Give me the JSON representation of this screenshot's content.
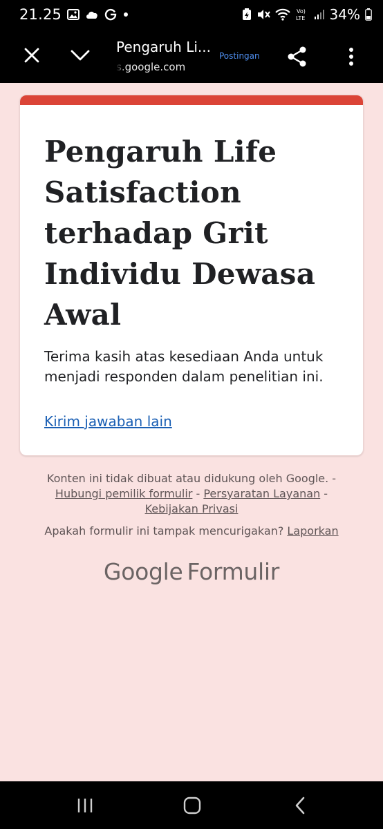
{
  "status_bar": {
    "time": "21.25",
    "battery": "34%",
    "network_label": "Vo) LTE"
  },
  "toolbar": {
    "tab_title": "Pengaruh Li...",
    "url": "s.google.com",
    "action_label": "Postingan"
  },
  "form": {
    "accent_color": "#db4437",
    "title": "Pengaruh Life Satisfaction terhadap Grit Individu Dewasa Awal",
    "message": "Terima kasih atas kesediaan Anda untuk menjadi responden dalam penelitian ini.",
    "resubmit_link": "Kirim jawaban lain"
  },
  "footer": {
    "disclaimer": "Konten ini tidak dibuat atau didukung oleh Google.",
    "separator": " - ",
    "contact_link": "Hubungi pemilik formulir",
    "terms_link": "Persyaratan Layanan",
    "privacy_link": "Kebijakan Privasi",
    "report_question": "Apakah formulir ini tampak mencurigakan?",
    "report_link": "Laporkan",
    "brand_google": "Google",
    "brand_product": "Formulir"
  }
}
